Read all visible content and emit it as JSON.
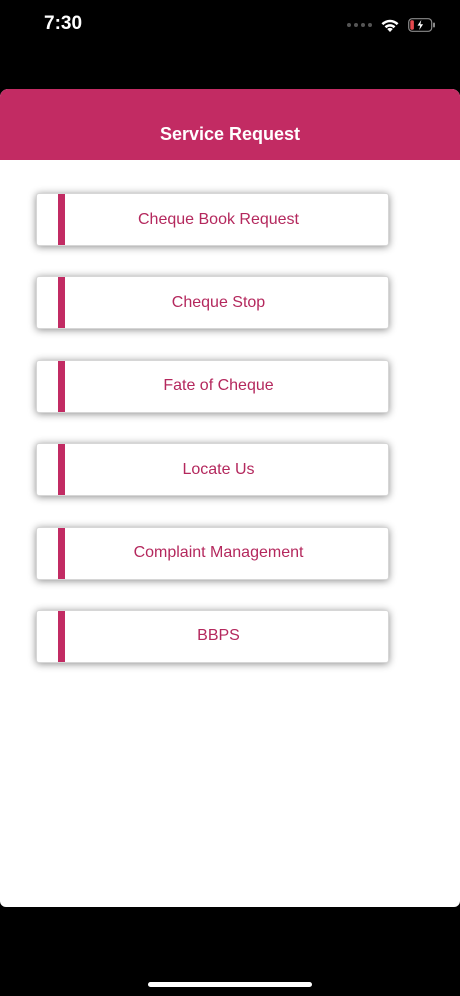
{
  "status_bar": {
    "time": "7:30",
    "icons": [
      "signal-icon",
      "wifi-icon",
      "battery-charging-icon"
    ],
    "battery_color": "#e5484d"
  },
  "header": {
    "title": "Service Request",
    "color": "#c22b63"
  },
  "menu": {
    "items": [
      {
        "label": "Cheque Book Request"
      },
      {
        "label": "Cheque Stop"
      },
      {
        "label": "Fate of Cheque"
      },
      {
        "label": "Locate Us"
      },
      {
        "label": "Complaint Management"
      },
      {
        "label": "BBPS"
      }
    ]
  }
}
